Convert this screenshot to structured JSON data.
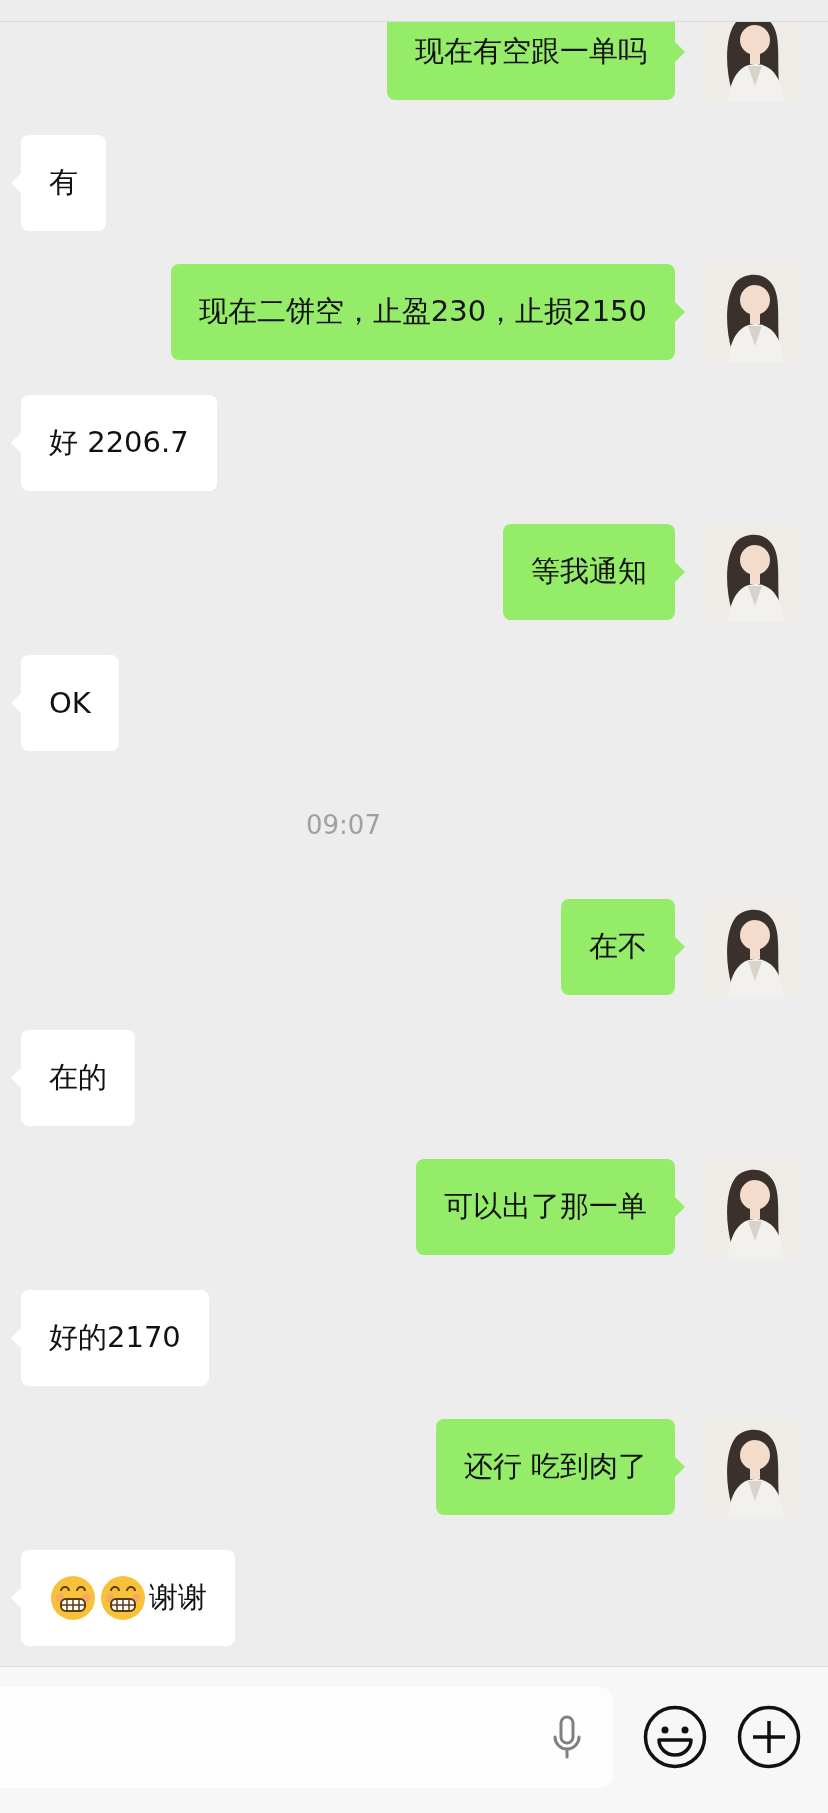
{
  "messages": [
    {
      "kind": "outgoing",
      "text": "现在有空跟一单吗"
    },
    {
      "kind": "incoming",
      "text": "有"
    },
    {
      "kind": "outgoing",
      "text": "现在二饼空，止盈230，止损2150"
    },
    {
      "kind": "incoming",
      "text": "好 2206.7"
    },
    {
      "kind": "outgoing",
      "text": "等我通知"
    },
    {
      "kind": "incoming",
      "text": "OK"
    },
    {
      "kind": "time",
      "text": "09:07"
    },
    {
      "kind": "outgoing",
      "text": "在不"
    },
    {
      "kind": "incoming",
      "text": "在的"
    },
    {
      "kind": "outgoing",
      "text": "可以出了那一单"
    },
    {
      "kind": "incoming",
      "text": "好的2170"
    },
    {
      "kind": "outgoing",
      "text": "还行 吃到肉了"
    },
    {
      "kind": "incoming",
      "text": "谢谢",
      "stickers": [
        {
          "kind": "grin"
        },
        {
          "kind": "grin"
        }
      ]
    }
  ]
}
